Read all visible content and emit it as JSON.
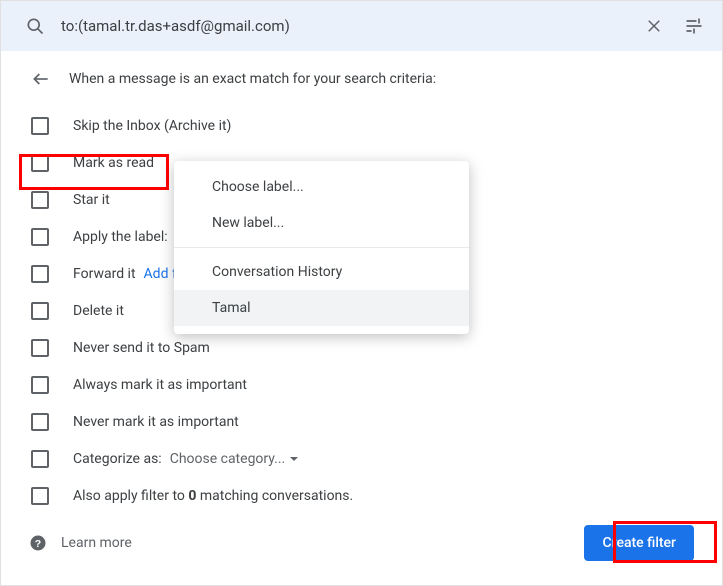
{
  "search": {
    "query": "to:(tamal.tr.das+asdf@gmail.com)"
  },
  "header": {
    "text": "When a message is an exact match for your search criteria:"
  },
  "options": {
    "skip_inbox": "Skip the Inbox (Archive it)",
    "mark_read": "Mark as read",
    "star_it": "Star it",
    "apply_label": "Apply the label:",
    "forward_it": "Forward it",
    "forward_link": "Add forwarding address",
    "delete_it": "Delete it",
    "never_spam": "Never send it to Spam",
    "always_important": "Always mark it as important",
    "never_important": "Never mark it as important",
    "categorize_as": "Categorize as:",
    "categorize_trigger": "Choose category...",
    "also_apply_pre": "Also apply filter to ",
    "also_apply_count": "0",
    "also_apply_post": " matching conversations."
  },
  "label_menu": {
    "choose": "Choose label...",
    "new_label": "New label...",
    "conv_history": "Conversation History",
    "tamal": "Tamal"
  },
  "footer": {
    "learn_more": "Learn more",
    "create_filter": "Create filter"
  }
}
